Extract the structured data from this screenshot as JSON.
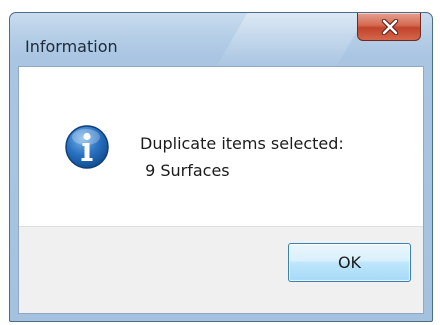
{
  "dialog": {
    "title": "Information",
    "close_icon": "close-icon",
    "message_icon": "info-icon",
    "message_lines": [
      "Duplicate items selected:",
      " 9 Surfaces"
    ],
    "ok_label": "OK"
  },
  "colors": {
    "close_button": "#c0442b",
    "ok_button_border": "#3c7fb1",
    "info_icon": "#1d5fa8"
  }
}
